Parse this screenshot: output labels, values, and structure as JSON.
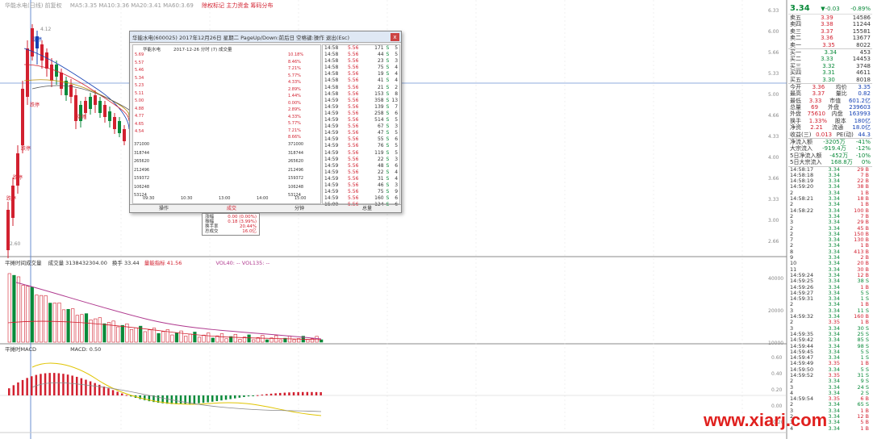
{
  "topline": {
    "indicator": "华能水电(日线) 前复权",
    "ma_info": "MA5:3.35 MA10:3.36 MA20:3.41 MA60:3.69",
    "legend": "除权标记 主力资金 筹码分布"
  },
  "kline_annotations": {
    "high_marker": "4.12",
    "low_marker": "2.60",
    "label_a": "涨停",
    "label_b": "跌停"
  },
  "quote": {
    "price": "3.34",
    "change": "▼-0.03",
    "change_pct": "-0.89%",
    "asks": [
      {
        "label": "卖五",
        "price": "3.39",
        "vol": "14586"
      },
      {
        "label": "卖四",
        "price": "3.38",
        "vol": "11244"
      },
      {
        "label": "卖三",
        "price": "3.37",
        "vol": "15581"
      },
      {
        "label": "卖二",
        "price": "3.36",
        "vol": "13677"
      },
      {
        "label": "卖一",
        "price": "3.35",
        "vol": "8022"
      }
    ],
    "bids": [
      {
        "label": "买一",
        "price": "3.34",
        "vol": "453"
      },
      {
        "label": "买二",
        "price": "3.33",
        "vol": "14453"
      },
      {
        "label": "买三",
        "price": "3.32",
        "vol": "3748"
      },
      {
        "label": "买四",
        "price": "3.31",
        "vol": "4611"
      },
      {
        "label": "买五",
        "price": "3.30",
        "vol": "8018"
      }
    ],
    "stats": [
      {
        "k1": "今开",
        "v1": "3.36",
        "k2": "均价",
        "v2": "3.35"
      },
      {
        "k1": "最高",
        "v1": "3.37",
        "k2": "量比",
        "v2": "0.82"
      },
      {
        "k1": "最低",
        "v1": "3.33",
        "k2": "市值",
        "v2": "601.2亿"
      },
      {
        "k1": "总量",
        "v1": "69",
        "k2": "外盘",
        "v2": "239603"
      },
      {
        "k1": "外盘",
        "v1": "75610",
        "k2": "内盘",
        "v2": "163993"
      },
      {
        "k1": "换手",
        "v1": "1.33%",
        "k2": "股本",
        "v2": "180亿"
      },
      {
        "k1": "净资",
        "v1": "2.21",
        "k2": "流通",
        "v2": "18.0亿"
      },
      {
        "k1": "收益(三)",
        "v1": "0.013",
        "k2": "PE(动)",
        "v2": "44.3"
      }
    ],
    "flows": [
      {
        "label": "净流入额",
        "value": "-3205万",
        "pct": "-41%"
      },
      {
        "label": "大宗流入",
        "value": "-919.4万",
        "pct": "-12%"
      },
      {
        "label": "5日净流入额",
        "value": "-452万",
        "pct": "-10%"
      },
      {
        "label": "5日大宗流入",
        "value": "168.8万",
        "pct": "0%"
      }
    ],
    "ticks": [
      {
        "t": "14:58:17",
        "p": "3.34",
        "v": "29 B"
      },
      {
        "t": "14:58:18",
        "p": "3.34",
        "v": "7 B"
      },
      {
        "t": "14:58:19",
        "p": "3.34",
        "v": "22 B"
      },
      {
        "t": "14:59:20",
        "p": "3.34",
        "v": "38 B"
      },
      {
        "t": "2",
        "p": "3.34",
        "v": "1 B"
      },
      {
        "t": "14:58:21",
        "p": "3.34",
        "v": "18 B"
      },
      {
        "t": "2",
        "p": "3.34",
        "v": "1 B"
      },
      {
        "t": "14:58:22",
        "p": "3.34",
        "v": "100 B"
      },
      {
        "t": "2",
        "p": "3.34",
        "v": "7 B"
      },
      {
        "t": "3",
        "p": "3.34",
        "v": "29 B"
      },
      {
        "t": "2",
        "p": "3.34",
        "v": "45 B"
      },
      {
        "t": "2",
        "p": "3.34",
        "v": "150 B"
      },
      {
        "t": "7",
        "p": "3.34",
        "v": "130 B"
      },
      {
        "t": "2",
        "p": "3.34",
        "v": "1 B"
      },
      {
        "t": "8",
        "p": "3.34",
        "v": "413 B"
      },
      {
        "t": "9",
        "p": "3.34",
        "v": "2 B"
      },
      {
        "t": "10",
        "p": "3.34",
        "v": "20 B"
      },
      {
        "t": "11",
        "p": "3.34",
        "v": "30 B"
      },
      {
        "t": "14:59:24",
        "p": "3.34",
        "v": "12 B"
      },
      {
        "t": "14:59:25",
        "p": "3.34",
        "v": "38 S"
      },
      {
        "t": "14:59:26",
        "p": "3.34",
        "v": "1 B"
      },
      {
        "t": "14:59:27",
        "p": "3.34",
        "v": "5 S"
      },
      {
        "t": "14:59:31",
        "p": "3.34",
        "v": "1 S"
      },
      {
        "t": "2",
        "p": "3.34",
        "v": "1 B"
      },
      {
        "t": "3",
        "p": "3.34",
        "v": "11 S"
      },
      {
        "t": "14:59:32",
        "p": "3.34",
        "v": "160 B"
      },
      {
        "t": "2",
        "p": "3.35",
        "v": "1 B"
      },
      {
        "t": "3",
        "p": "3.34",
        "v": "30 S"
      },
      {
        "t": "14:59:35",
        "p": "3.34",
        "v": "25 S"
      },
      {
        "t": "14:59:42",
        "p": "3.34",
        "v": "85 S"
      },
      {
        "t": "14:59:44",
        "p": "3.34",
        "v": "98 S"
      },
      {
        "t": "14:59:45",
        "p": "3.34",
        "v": "5 S"
      },
      {
        "t": "14:59:47",
        "p": "3.34",
        "v": "1 S"
      },
      {
        "t": "14:59:49",
        "p": "3.35",
        "v": "1 B"
      },
      {
        "t": "14:59:50",
        "p": "3.34",
        "v": "5 S"
      },
      {
        "t": "14:59:52",
        "p": "3.35",
        "v": "31 S"
      },
      {
        "t": "2",
        "p": "3.34",
        "v": "9 S"
      },
      {
        "t": "3",
        "p": "3.34",
        "v": "24 S"
      },
      {
        "t": "4",
        "p": "3.34",
        "v": "2 S"
      },
      {
        "t": "14:59:54",
        "p": "3.35",
        "v": "6 B"
      },
      {
        "t": "2",
        "p": "3.34",
        "v": "65 S"
      },
      {
        "t": "3",
        "p": "3.34",
        "v": "1 B"
      },
      {
        "t": "2",
        "p": "3.34",
        "v": "12 B"
      },
      {
        "t": "3",
        "p": "3.34",
        "v": "5 B"
      },
      {
        "t": "4",
        "p": "3.34",
        "v": "1 B"
      }
    ]
  },
  "popup": {
    "title": "华能水电(600025) 2017年12月26日 星期二 PageUp/Down:前后日 空格键:操作 退出(Esc)",
    "chart_title": "华能水电",
    "chart_subtitle": "2017-12-26 分时 (7) 成交量",
    "close_label": "x",
    "price_axis_left": [
      "5.69",
      "5.57",
      "5.46",
      "5.34",
      "5.23",
      "5.11",
      "5.00",
      "4.88",
      "4.77",
      "4.65",
      "4.54"
    ],
    "price_axis_right": [
      "10.18%",
      "8.46%",
      "7.21%",
      "5.77%",
      "4.33%",
      "2.89%",
      "1.44%",
      "0.00%",
      "2.89%",
      "4.33%",
      "5.77%",
      "7.21%",
      "8.66%"
    ],
    "vol_axis": [
      "371000",
      "318744",
      "265620",
      "212496",
      "159372",
      "106248",
      "53124"
    ],
    "time_axis": [
      "09:30",
      "10:30",
      "13:00",
      "14:00",
      "15:00"
    ],
    "ticks": [
      {
        "t": "14:58",
        "p": "5.56",
        "v": "171",
        "s": "S",
        "n": "5"
      },
      {
        "t": "14:58",
        "p": "5.56",
        "v": "44",
        "s": "S",
        "n": "5"
      },
      {
        "t": "14:58",
        "p": "5.56",
        "v": "23",
        "s": "S",
        "n": "3"
      },
      {
        "t": "14:58",
        "p": "5.56",
        "v": "75",
        "s": "S",
        "n": "4"
      },
      {
        "t": "14:58",
        "p": "5.56",
        "v": "19",
        "s": "S",
        "n": "4"
      },
      {
        "t": "14:58",
        "p": "5.56",
        "v": "41",
        "s": "S",
        "n": "4"
      },
      {
        "t": "14:58",
        "p": "5.56",
        "v": "21",
        "s": "S",
        "n": "2"
      },
      {
        "t": "14:58",
        "p": "5.56",
        "v": "153",
        "s": "S",
        "n": "8"
      },
      {
        "t": "14:59",
        "p": "5.56",
        "v": "358",
        "s": "S",
        "n": "13"
      },
      {
        "t": "14:59",
        "p": "5.56",
        "v": "139",
        "s": "S",
        "n": "7"
      },
      {
        "t": "14:59",
        "p": "5.56",
        "v": "258",
        "s": "S",
        "n": "6"
      },
      {
        "t": "14:59",
        "p": "5.56",
        "v": "514",
        "s": "S",
        "n": "5"
      },
      {
        "t": "14:59",
        "p": "5.56",
        "v": "67",
        "s": "S",
        "n": "3"
      },
      {
        "t": "14:59",
        "p": "5.56",
        "v": "47",
        "s": "S",
        "n": "5"
      },
      {
        "t": "14:59",
        "p": "5.56",
        "v": "55",
        "s": "S",
        "n": "6"
      },
      {
        "t": "14:59",
        "p": "5.56",
        "v": "76",
        "s": "S",
        "n": "5"
      },
      {
        "t": "14:59",
        "p": "5.56",
        "v": "119",
        "s": "S",
        "n": "5"
      },
      {
        "t": "14:59",
        "p": "5.56",
        "v": "22",
        "s": "S",
        "n": "3"
      },
      {
        "t": "14:59",
        "p": "5.56",
        "v": "48",
        "s": "S",
        "n": "6"
      },
      {
        "t": "14:59",
        "p": "5.56",
        "v": "22",
        "s": "S",
        "n": "4"
      },
      {
        "t": "14:59",
        "p": "5.56",
        "v": "31",
        "s": "S",
        "n": "4"
      },
      {
        "t": "14:59",
        "p": "5.56",
        "v": "46",
        "s": "S",
        "n": "3"
      },
      {
        "t": "14:59",
        "p": "5.56",
        "v": "75",
        "s": "S",
        "n": "9"
      },
      {
        "t": "14:59",
        "p": "5.56",
        "v": "160",
        "s": "S",
        "n": "6"
      },
      {
        "t": "15:00",
        "p": "5.56",
        "v": "124",
        "s": "S",
        "n": "6"
      }
    ],
    "footer": [
      "操作",
      "成交",
      "分钟",
      "总量"
    ]
  },
  "tooltip": {
    "rows": [
      {
        "k": "涨幅",
        "v": "0.00 (0.00%)"
      },
      {
        "k": "振幅",
        "v": "0.18 (3.99%)"
      },
      {
        "k": "换手率",
        "v": "20.44%"
      },
      {
        "k": "总成交",
        "v": "16.0亿"
      }
    ]
  },
  "volume_pane": {
    "label": "平摊时间成交量",
    "vol_text": "成交量 3138432304.00",
    "turnover": "换手 33.44",
    "extra": "量能指标 41.56",
    "ma_text": "VOL40: --  VOL135: --",
    "axis": [
      "40000",
      "20000",
      "10000"
    ]
  },
  "macd_pane": {
    "label": "平摊时MACD",
    "value": "MACD: 0.50",
    "axis": [
      "0.60",
      "0.40",
      "0.20",
      "0.00",
      "-0.20"
    ]
  },
  "price_axis": [
    "6.33",
    "6.00",
    "5.66",
    "5.33",
    "5.00",
    "4.66",
    "4.33",
    "4.00",
    "3.66",
    "3.33",
    "3.00",
    "2.66"
  ],
  "watermark": "www.xiarj.com"
}
